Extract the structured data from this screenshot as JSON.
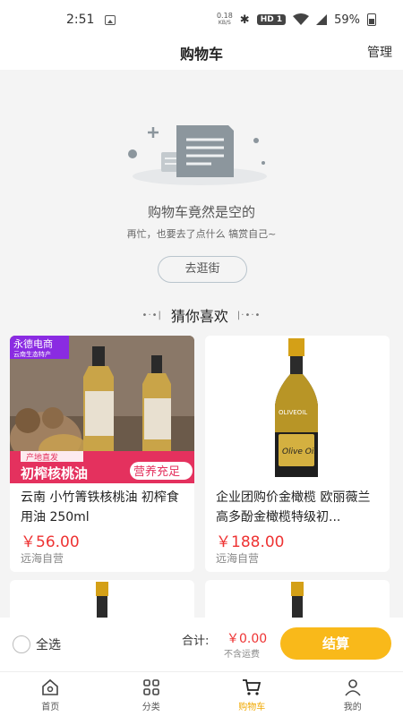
{
  "status": {
    "time": "2:51",
    "speed_value": "0.18",
    "speed_unit": "KB/S",
    "hd_label": "HD 1",
    "battery": "59%"
  },
  "header": {
    "title": "购物车",
    "manage": "管理"
  },
  "empty_state": {
    "title": "购物车竟然是空的",
    "subtitle": "再忙，也要去了点什么 犒赏自己~",
    "button": "去逛街"
  },
  "recommend": {
    "title": "猜你喜欢",
    "products": [
      {
        "badge_store": "永德电商",
        "badge_store_sub": "云南生态特产",
        "badge_origin": "产地直发",
        "banner_left": "初榨核桃油",
        "banner_right": "营养充足",
        "name": "云南 小竹箐铁核桃油 初榨食用油 250ml",
        "price": "￥56.00",
        "seller": "远海自营"
      },
      {
        "label_brand": "OLIVEOIL",
        "label_text": "Olive Oil",
        "name": "企业团购价金橄榄 欧丽薇兰高多酚金橄榄特级初...",
        "price": "￥188.00",
        "seller": "远海自营"
      }
    ]
  },
  "checkout": {
    "select_all": "全选",
    "total_label": "合计:",
    "total_value": "￥0.00",
    "shipping_note": "不含运费",
    "pay_button": "结算"
  },
  "tabs": [
    {
      "label": "首页",
      "icon": "home-icon"
    },
    {
      "label": "分类",
      "icon": "grid-icon"
    },
    {
      "label": "购物车",
      "icon": "cart-icon",
      "active": true
    },
    {
      "label": "我的",
      "icon": "user-icon"
    }
  ],
  "colors": {
    "accent": "#f9b91a",
    "price": "#ee3333",
    "badge_purple": "#8a2be2",
    "banner_pink": "#e4315e"
  }
}
